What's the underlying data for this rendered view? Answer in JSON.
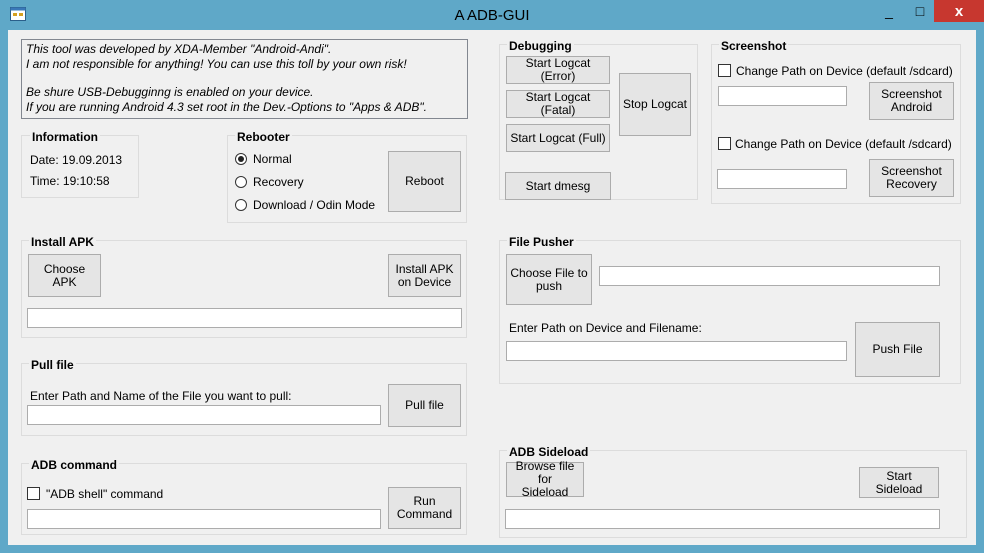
{
  "window": {
    "title": "A ADB-GUI",
    "minimize": "_",
    "maximize": "□",
    "close": "x"
  },
  "notice": {
    "line1": "This tool was developed  by XDA-Member \"Android-Andi\".",
    "line2": "I am not responsible for anything! You can use this toll by your own risk!",
    "line3": "Be shure USB-Debugginng is enabled on your device.",
    "line4": "If you are running Android 4.3 set root in the Dev.-Options to \"Apps & ADB\"."
  },
  "information": {
    "title": "Information",
    "date": "Date: 19.09.2013",
    "time": "Time: 19:10:58"
  },
  "rebooter": {
    "title": "Rebooter",
    "options": [
      "Normal",
      "Recovery",
      "Download / Odin Mode"
    ],
    "selected": "Normal",
    "reboot_label": "Reboot"
  },
  "debugging": {
    "title": "Debugging",
    "logcat_error": "Start Logcat (Error)",
    "logcat_fatal": "Start Logcat (Fatal)",
    "logcat_full": "Start Logcat (Full)",
    "stop_logcat": "Stop Logcat",
    "dmesg": "Start dmesg"
  },
  "screenshot": {
    "title": "Screenshot",
    "change_path_1": "Change Path on Device (default /sdcard)",
    "change_path_2": "Change Path on Device (default /sdcard)",
    "android_l1": "Screenshot",
    "android_l2": "Android",
    "recovery_l1": "Screenshot",
    "recovery_l2": "Recovery",
    "path1_value": "",
    "path2_value": ""
  },
  "install_apk": {
    "title": "Install APK",
    "choose_label": "Choose APK",
    "install_l1": "Install APK",
    "install_l2": "on Device",
    "path_value": ""
  },
  "file_pusher": {
    "title": "File Pusher",
    "choose_l1": "Choose File to",
    "choose_l2": "push",
    "path_label": "Enter Path on Device and Filename:",
    "push_label": "Push File",
    "file_value": "",
    "device_path_value": ""
  },
  "pull_file": {
    "title": "Pull file",
    "prompt": "Enter Path and Name of the File you want to pull:",
    "pull_label": "Pull file",
    "path_value": ""
  },
  "adb_command": {
    "title": "ADB command",
    "shell_label": "\"ADB shell\" command",
    "run_l1": "Run",
    "run_l2": "Command",
    "command_value": ""
  },
  "sideload": {
    "title": "ADB Sideload",
    "browse_l1": "Browse file for",
    "browse_l2": "Sideload",
    "start_label": "Start Sideload",
    "path_value": ""
  },
  "colors": {
    "titlebar": "#5fa8c8",
    "close": "#c7372f",
    "client": "#f0f0f0"
  }
}
